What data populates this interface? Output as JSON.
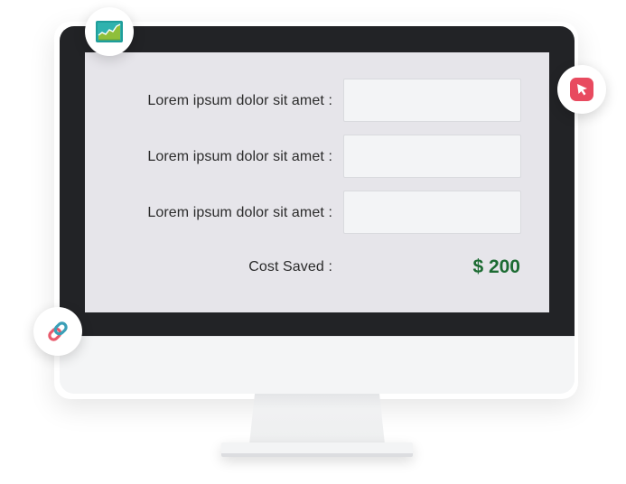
{
  "form": {
    "rows": [
      {
        "label": "Lorem ipsum dolor sit amet :",
        "value": ""
      },
      {
        "label": "Lorem ipsum dolor sit amet :",
        "value": ""
      },
      {
        "label": "Lorem ipsum dolor sit amet :",
        "value": ""
      }
    ],
    "cost_label": "Cost Saved :",
    "cost_value": "$ 200"
  },
  "badges": {
    "chart": {
      "icon": "chart-icon"
    },
    "cursor": {
      "icon": "cursor-icon"
    },
    "link": {
      "icon": "link-icon"
    }
  },
  "colors": {
    "accent_green": "#1c6b32",
    "cursor_red": "#e84a5f",
    "bezel": "#222326",
    "screen": "#e6e5ea"
  }
}
